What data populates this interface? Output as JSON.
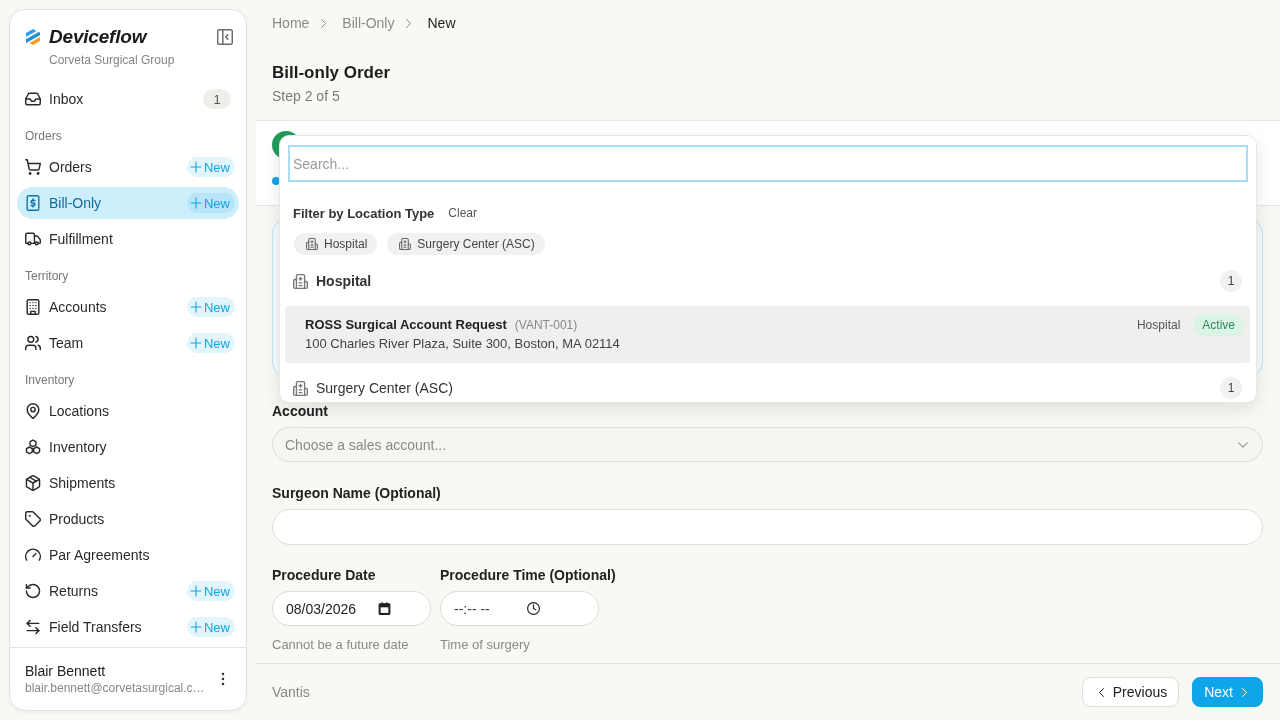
{
  "sidebar": {
    "brand": "Deviceflow",
    "organization": "Corveta Surgical Group",
    "nav": [
      {
        "items": [
          {
            "label": "Inbox",
            "badge": "1",
            "selected": false
          }
        ]
      },
      {
        "heading": "Orders",
        "items": [
          {
            "label": "Orders",
            "action": "New",
            "selected": false
          },
          {
            "label": "Bill-Only",
            "action": "New",
            "selected": true
          },
          {
            "label": "Fulfillment",
            "selected": false
          }
        ]
      },
      {
        "heading": "Territory",
        "items": [
          {
            "label": "Accounts",
            "action": "New",
            "selected": false
          },
          {
            "label": "Team",
            "action": "New",
            "selected": false
          }
        ]
      },
      {
        "heading": "Inventory",
        "items": [
          {
            "label": "Locations",
            "selected": false
          },
          {
            "label": "Inventory",
            "selected": false
          },
          {
            "label": "Shipments",
            "selected": false
          },
          {
            "label": "Products",
            "selected": false
          },
          {
            "label": "Par Agreements",
            "selected": false
          },
          {
            "label": "Returns",
            "action": "New",
            "selected": false
          },
          {
            "label": "Field Transfers",
            "action": "New",
            "selected": false
          }
        ]
      }
    ],
    "user": {
      "name": "Blair Bennett",
      "email": "blair.bennett@corvetasurgical.c…"
    }
  },
  "breadcrumb": [
    {
      "label": "Home",
      "current": false
    },
    {
      "label": "Bill-Only",
      "current": false
    },
    {
      "label": "New",
      "current": true
    }
  ],
  "page": {
    "title": "Bill-only Order",
    "subtitle": "Step 2 of 5"
  },
  "stepper": {
    "steps": [
      {
        "completed": true
      }
    ]
  },
  "form": {
    "account": {
      "label": "Account",
      "placeholder": "Choose a sales account..."
    },
    "surgeon": {
      "label": "Surgeon Name (Optional)"
    },
    "procedure_date": {
      "label": "Procedure Date",
      "value": "08/03/2026",
      "hint": "Cannot be a future date"
    },
    "procedure_time": {
      "label": "Procedure Time (Optional)",
      "value": "--:-- --",
      "hint": "Time of surgery"
    }
  },
  "footer": {
    "brand": "Vantis",
    "buttons": [
      {
        "label": "Previous",
        "kind": "back"
      },
      {
        "label": "Next",
        "kind": "forward"
      }
    ]
  },
  "location_dropdown": {
    "search_placeholder": "Search...",
    "filter_title": "Filter by Location Type",
    "clear": "Clear",
    "filters": [
      {
        "label": "Hospital",
        "selected": false
      },
      {
        "label": "Surgery Center (ASC)",
        "selected": false
      }
    ],
    "groups": [
      {
        "label": "Hospital",
        "count": "1",
        "options": [
          {
            "name": "ROSS Surgical Account Request",
            "code": "(VANT-001)",
            "address": "100 Charles River Plaza, Suite 300, Boston, MA 02114",
            "type": "Hospital",
            "status": "Active",
            "highlighted": true
          }
        ]
      },
      {
        "label": "Surgery Center (ASC)",
        "count": "1"
      }
    ]
  }
}
